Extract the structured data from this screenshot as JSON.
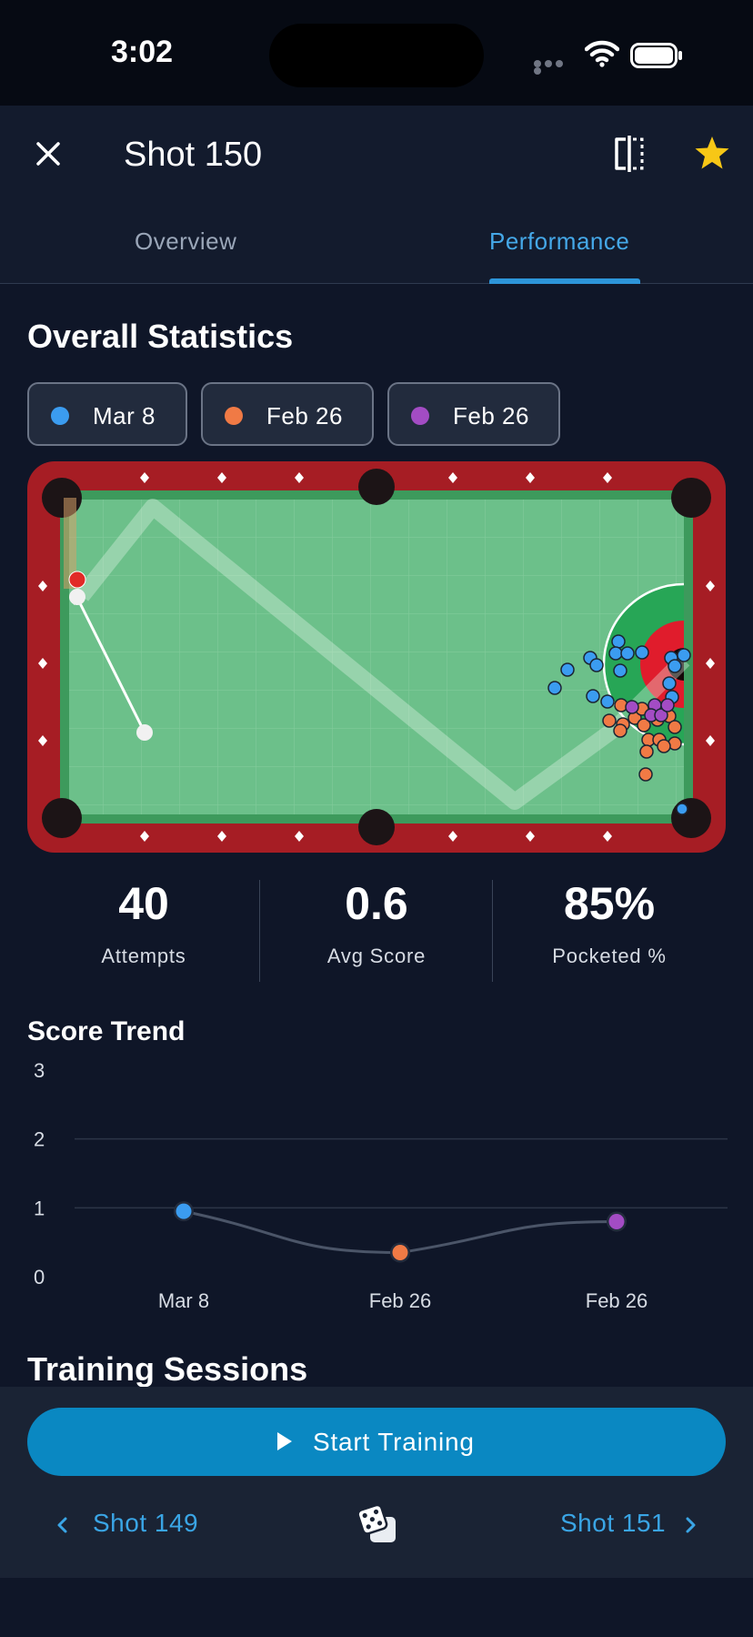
{
  "status_bar": {
    "time": "3:02"
  },
  "header": {
    "title": "Shot 150",
    "tabs": [
      {
        "label": "Overview",
        "active": false
      },
      {
        "label": "Performance",
        "active": true
      }
    ]
  },
  "overall": {
    "title": "Overall Statistics",
    "filters": [
      {
        "label": "Mar 8",
        "color": "#3b9cf0"
      },
      {
        "label": "Feb 26",
        "color": "#f07a45"
      },
      {
        "label": "Feb 26",
        "color": "#a34cc4"
      }
    ],
    "stats": [
      {
        "value": "40",
        "label": "Attempts"
      },
      {
        "value": "0.6",
        "label": "Avg Score"
      },
      {
        "value": "85%",
        "label": "Pocketed %"
      }
    ]
  },
  "score_trend": {
    "title": "Score Trend",
    "y_ticks": [
      "3",
      "2",
      "1",
      "0"
    ],
    "x_labels": [
      "Mar 8",
      "Feb 26",
      "Feb 26"
    ]
  },
  "chart_data": {
    "type": "line",
    "categories": [
      "Mar 8",
      "Feb 26",
      "Feb 26"
    ],
    "values": [
      0.95,
      0.35,
      0.8
    ],
    "point_colors": [
      "#3b9cf0",
      "#f07a45",
      "#a34cc4"
    ],
    "ylim": [
      0,
      3
    ],
    "grid": true,
    "title": "Score Trend",
    "xlabel": "",
    "ylabel": ""
  },
  "training": {
    "title": "Training Sessions"
  },
  "bottom": {
    "start_label": "Start Training",
    "prev_label": "Shot 149",
    "next_label": "Shot 151"
  },
  "colors": {
    "accent": "#0a88c2",
    "felt": "#6cc08a",
    "rail": "#a61d24",
    "background": "#0f1628"
  }
}
